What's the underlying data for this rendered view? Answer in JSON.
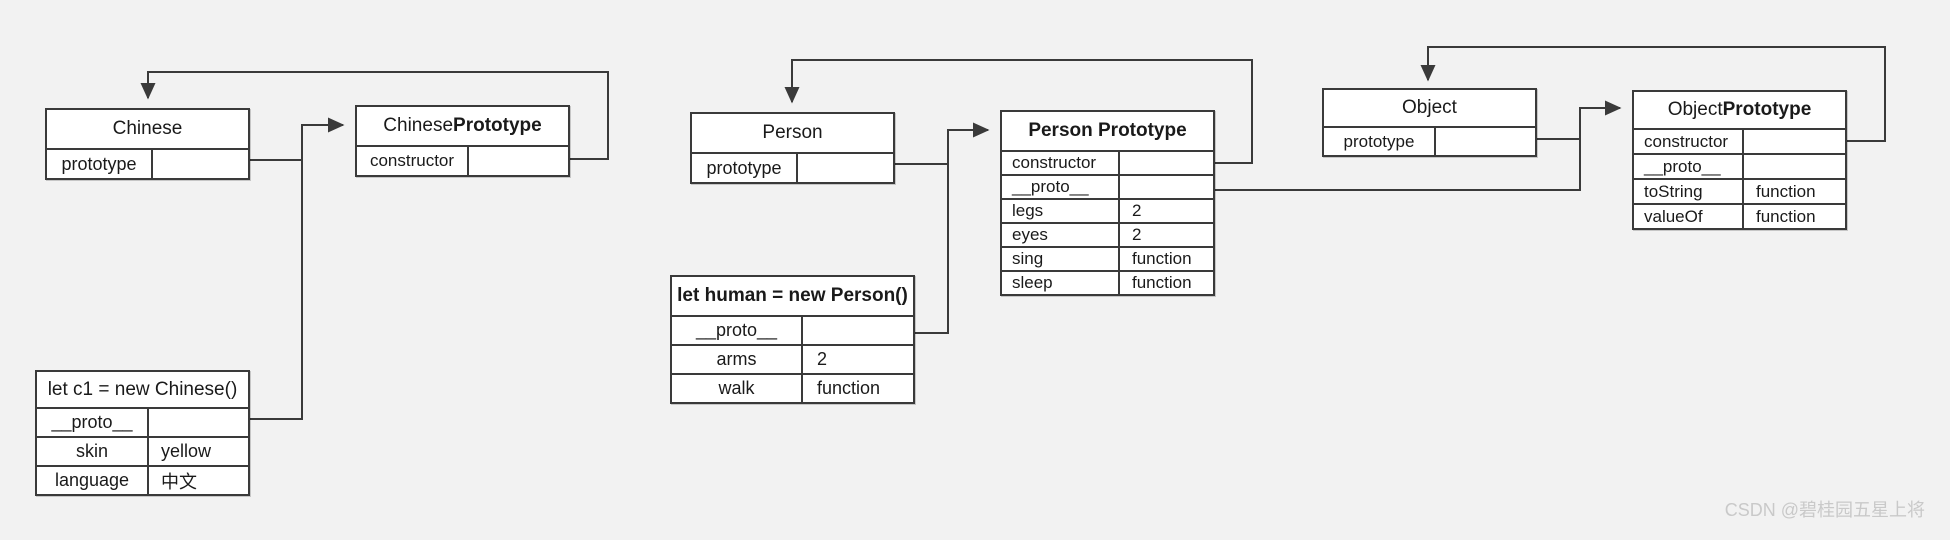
{
  "diagram": {
    "title": "JavaScript prototype chain diagram",
    "background_color": "#f2f2f2",
    "box_border_color": "#3a3a3a",
    "box_fill_color": "#ffffff",
    "edge_color": "#3a3a3a"
  },
  "nodes": {
    "chinese": {
      "title": "Chinese",
      "rows": [
        {
          "key": "prototype",
          "value": ""
        }
      ]
    },
    "chinese_prototype": {
      "title_prefix": "Chinese ",
      "title_bold": "Prototype",
      "rows": [
        {
          "key": "constructor",
          "value": ""
        }
      ]
    },
    "c1": {
      "title": "let c1 = new Chinese()",
      "rows": [
        {
          "key": "__proto__",
          "value": ""
        },
        {
          "key": "skin",
          "value": "yellow"
        },
        {
          "key": "language",
          "value": "中文"
        }
      ]
    },
    "person": {
      "title": "Person",
      "rows": [
        {
          "key": "prototype",
          "value": ""
        }
      ]
    },
    "person_prototype": {
      "title": "Person Prototype",
      "rows": [
        {
          "key": "constructor",
          "value": ""
        },
        {
          "key": "__proto__",
          "value": ""
        },
        {
          "key": "legs",
          "value": "2"
        },
        {
          "key": "eyes",
          "value": "2"
        },
        {
          "key": "sing",
          "value": "function"
        },
        {
          "key": "sleep",
          "value": "function"
        }
      ]
    },
    "human": {
      "title": "let human = new Person()",
      "rows": [
        {
          "key": "__proto__",
          "value": ""
        },
        {
          "key": "arms",
          "value": "2"
        },
        {
          "key": "walk",
          "value": "function"
        }
      ]
    },
    "object": {
      "title": "Object",
      "rows": [
        {
          "key": "prototype",
          "value": ""
        }
      ]
    },
    "object_prototype": {
      "title_prefix": "Object ",
      "title_bold": "Prototype",
      "rows": [
        {
          "key": "constructor",
          "value": ""
        },
        {
          "key": "__proto__",
          "value": ""
        },
        {
          "key": "toString",
          "value": "function"
        },
        {
          "key": "valueOf",
          "value": "function"
        }
      ]
    }
  },
  "edges": [
    {
      "name": "chinese-prototype-to-chinese-prototype-box",
      "from": "chinese.prototype",
      "to": "chinese_prototype.title"
    },
    {
      "name": "chinese-prototype-constructor-to-chinese",
      "from": "chinese_prototype.constructor",
      "to": "chinese.title"
    },
    {
      "name": "c1-proto-to-chinese-prototype-box",
      "from": "c1.__proto__",
      "to": "chinese_prototype.title"
    },
    {
      "name": "person-prototype-to-person-prototype-box",
      "from": "person.prototype",
      "to": "person_prototype.title"
    },
    {
      "name": "person-prototype-constructor-to-person",
      "from": "person_prototype.constructor",
      "to": "person.title"
    },
    {
      "name": "human-proto-to-person-prototype-box",
      "from": "human.__proto__",
      "to": "person_prototype.title"
    },
    {
      "name": "object-prototype-to-object-prototype-box",
      "from": "object.prototype",
      "to": "object_prototype.title"
    },
    {
      "name": "object-prototype-constructor-to-object",
      "from": "object_prototype.constructor",
      "to": "object.title"
    },
    {
      "name": "person-prototype-proto-to-object-prototype-box",
      "from": "person_prototype.__proto__",
      "to": "object_prototype.title"
    }
  ],
  "watermark": {
    "text": "CSDN @碧桂园五星上将"
  }
}
